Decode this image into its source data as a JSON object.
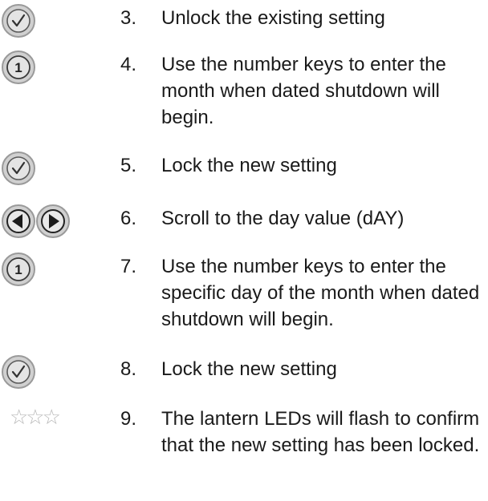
{
  "steps": [
    {
      "number": "3.",
      "text": "Unlock the existing setting",
      "icon": "check-key-icon"
    },
    {
      "number": "4.",
      "text": "Use the number keys to enter the month when dated shutdown will begin.",
      "icon": "number-key-icon",
      "key_label": "1"
    },
    {
      "number": "5.",
      "text": "Lock the new setting",
      "icon": "check-key-icon"
    },
    {
      "number": "6.",
      "text": "Scroll to the day value (dAY)",
      "icon": "arrow-keys-icon"
    },
    {
      "number": "7.",
      "text": "Use the number keys to enter the specific day of the month when dated shutdown will begin.",
      "icon": "number-key-icon",
      "key_label": "1"
    },
    {
      "number": "8.",
      "text": "Lock the new setting",
      "icon": "check-key-icon"
    },
    {
      "number": "9.",
      "text": "The lantern LEDs will flash to confirm that the new setting has been locked.",
      "icon": "flash-stars-icon",
      "stars": "☆☆☆"
    }
  ]
}
